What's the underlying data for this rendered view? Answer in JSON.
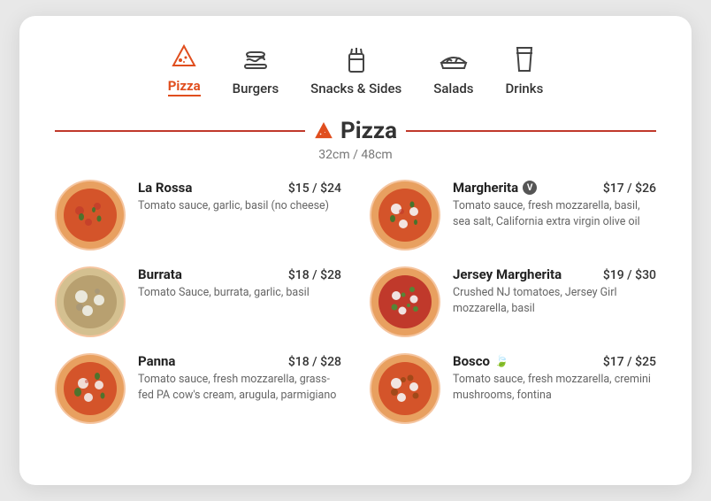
{
  "nav": {
    "items": [
      {
        "id": "pizza",
        "label": "Pizza",
        "active": true
      },
      {
        "id": "burgers",
        "label": "Burgers",
        "active": false
      },
      {
        "id": "snacks",
        "label": "Snacks & Sides",
        "active": false
      },
      {
        "id": "salads",
        "label": "Salads",
        "active": false
      },
      {
        "id": "drinks",
        "label": "Drinks",
        "active": false
      }
    ]
  },
  "section": {
    "title": "Pizza",
    "subtitle": "32cm / 48cm"
  },
  "menu": [
    {
      "id": "la-rossa",
      "name": "La Rossa",
      "price": "$15 / $24",
      "desc": "Tomato sauce, garlic, basil (no cheese)",
      "badge": null,
      "col": 0
    },
    {
      "id": "margherita",
      "name": "Margherita",
      "price": "$17 / $26",
      "desc": "Tomato sauce, fresh mozzarella, basil, sea salt, California extra virgin olive oil",
      "badge": "V",
      "col": 1
    },
    {
      "id": "burrata",
      "name": "Burrata",
      "price": "$18 / $28",
      "desc": "Tomato Sauce, burrata, garlic, basil",
      "badge": null,
      "col": 0
    },
    {
      "id": "jersey-margherita",
      "name": "Jersey Margherita",
      "price": "$19 / $30",
      "desc": "Crushed NJ tomatoes, Jersey Girl mozzarella, basil",
      "badge": null,
      "col": 1
    },
    {
      "id": "panna",
      "name": "Panna",
      "price": "$18 / $28",
      "desc": "Tomato sauce, fresh mozzarella, grass-fed PA cow's cream, arugula, parmigiano",
      "badge": null,
      "col": 0
    },
    {
      "id": "bosco",
      "name": "Bosco",
      "price": "$17 / $25",
      "desc": "Tomato sauce, fresh mozzarella, cremini mushrooms, fontina",
      "badge": "leaf",
      "col": 1
    }
  ],
  "colors": {
    "accent": "#e04e1e",
    "text_primary": "#222",
    "text_secondary": "#666"
  }
}
